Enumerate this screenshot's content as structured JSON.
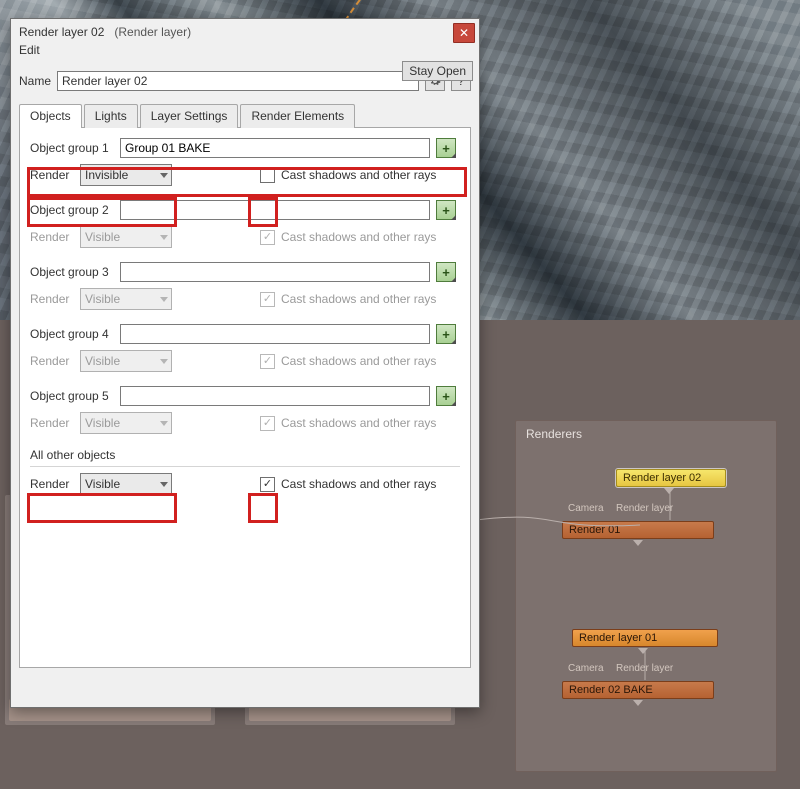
{
  "dialog": {
    "title": "Render layer 02",
    "type": "(Render layer)",
    "menu_edit": "Edit",
    "stay_open": "Stay Open",
    "help": "?",
    "name_label": "Name",
    "name_value": "Render layer 02",
    "tabs": {
      "objects": "Objects",
      "lights": "Lights",
      "layer_settings": "Layer Settings",
      "render_elements": "Render Elements"
    },
    "groups": [
      {
        "label": "Object group 1",
        "value": "Group 01 BAKE",
        "render_label": "Render",
        "render_value": "Invisible",
        "cast_label": "Cast shadows and other rays",
        "cast_checked": false,
        "enabled": true
      },
      {
        "label": "Object group 2",
        "value": "",
        "render_label": "Render",
        "render_value": "Visible",
        "cast_label": "Cast shadows and other rays",
        "cast_checked": true,
        "enabled": false
      },
      {
        "label": "Object group 3",
        "value": "",
        "render_label": "Render",
        "render_value": "Visible",
        "cast_label": "Cast shadows and other rays",
        "cast_checked": true,
        "enabled": false
      },
      {
        "label": "Object group 4",
        "value": "",
        "render_label": "Render",
        "render_value": "Visible",
        "cast_label": "Cast shadows and other rays",
        "cast_checked": true,
        "enabled": false
      },
      {
        "label": "Object group 5",
        "value": "",
        "render_label": "Render",
        "render_value": "Visible",
        "cast_label": "Cast shadows and other rays",
        "cast_checked": true,
        "enabled": false
      }
    ],
    "all_other_label": "All other objects",
    "all_other": {
      "render_label": "Render",
      "render_value": "Visible",
      "cast_label": "Cast shadows and other rays",
      "cast_checked": true
    }
  },
  "graph": {
    "box_title": "Renderers",
    "nodes": {
      "rl02": "Render layer 02",
      "r01": "Render 01",
      "rl01": "Render layer 01",
      "r02": "Render 02 BAKE"
    },
    "port_camera": "Camera",
    "port_renderlayer": "Render layer"
  }
}
